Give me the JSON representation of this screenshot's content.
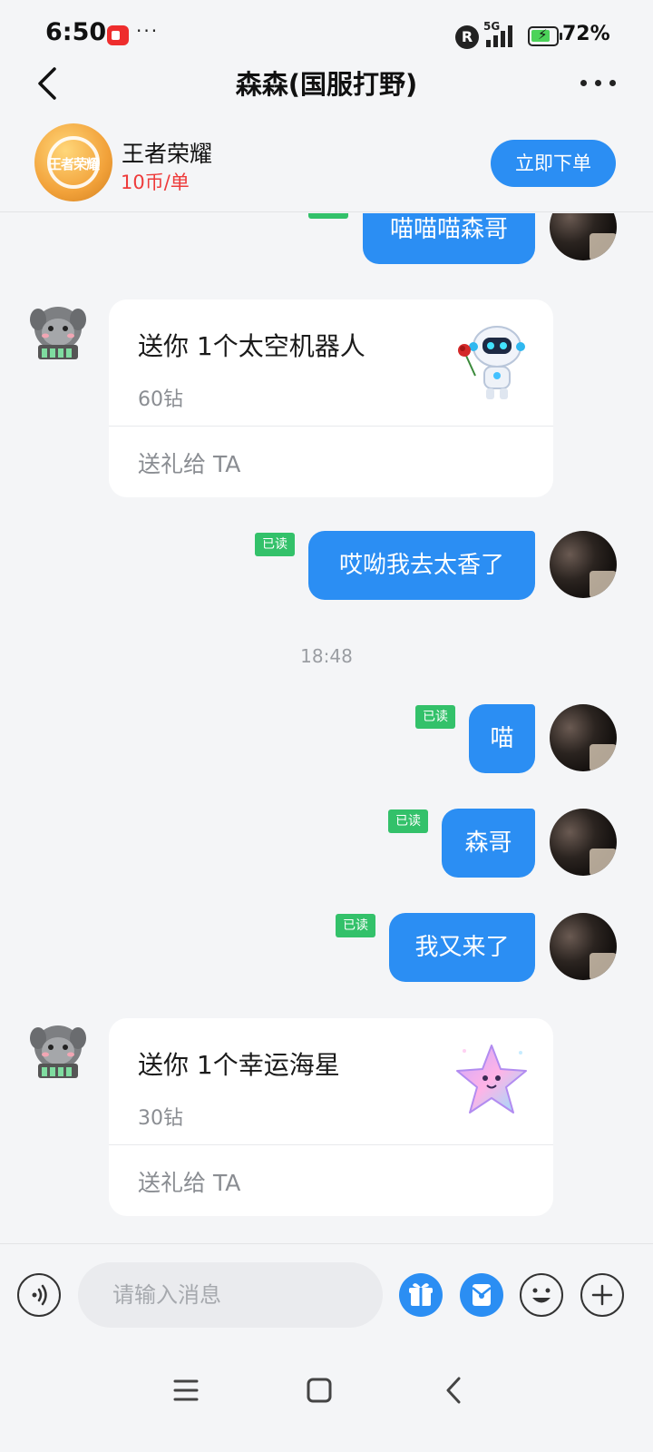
{
  "status_bar": {
    "time": "6:50",
    "dots": "···",
    "roaming": "R",
    "network": "5G",
    "battery": "72%"
  },
  "header": {
    "title": "森森(国服打野)"
  },
  "service": {
    "name": "王者荣耀",
    "price": "10币/单",
    "logo_text": "王者荣耀",
    "order_button": "立即下单"
  },
  "messages": {
    "m1": {
      "text": "喵喵喵森哥"
    },
    "gift1": {
      "title": "送你 1个太空机器人",
      "price": "60钻",
      "action": "送礼给 TA"
    },
    "m2": {
      "text": "哎呦我去太香了",
      "status": "已读"
    },
    "time1": "18:48",
    "m3": {
      "text": "喵",
      "status": "已读"
    },
    "m4": {
      "text": "森哥",
      "status": "已读"
    },
    "m5": {
      "text": "我又来了",
      "status": "已读"
    },
    "gift2": {
      "title": "送你 1个幸运海星",
      "price": "30钻",
      "action": "送礼给 TA"
    }
  },
  "input": {
    "placeholder": "请输入消息"
  },
  "colors": {
    "accent": "#2b8ef3",
    "read_badge": "#33c16a",
    "price_red": "#ee3b3b",
    "background": "#f4f5f7"
  },
  "icons": [
    "back-icon",
    "more-icon",
    "voice-icon",
    "gift-icon",
    "red-packet-icon",
    "emoji-icon",
    "plus-icon",
    "menu-icon",
    "home-icon",
    "nav-back-icon"
  ]
}
